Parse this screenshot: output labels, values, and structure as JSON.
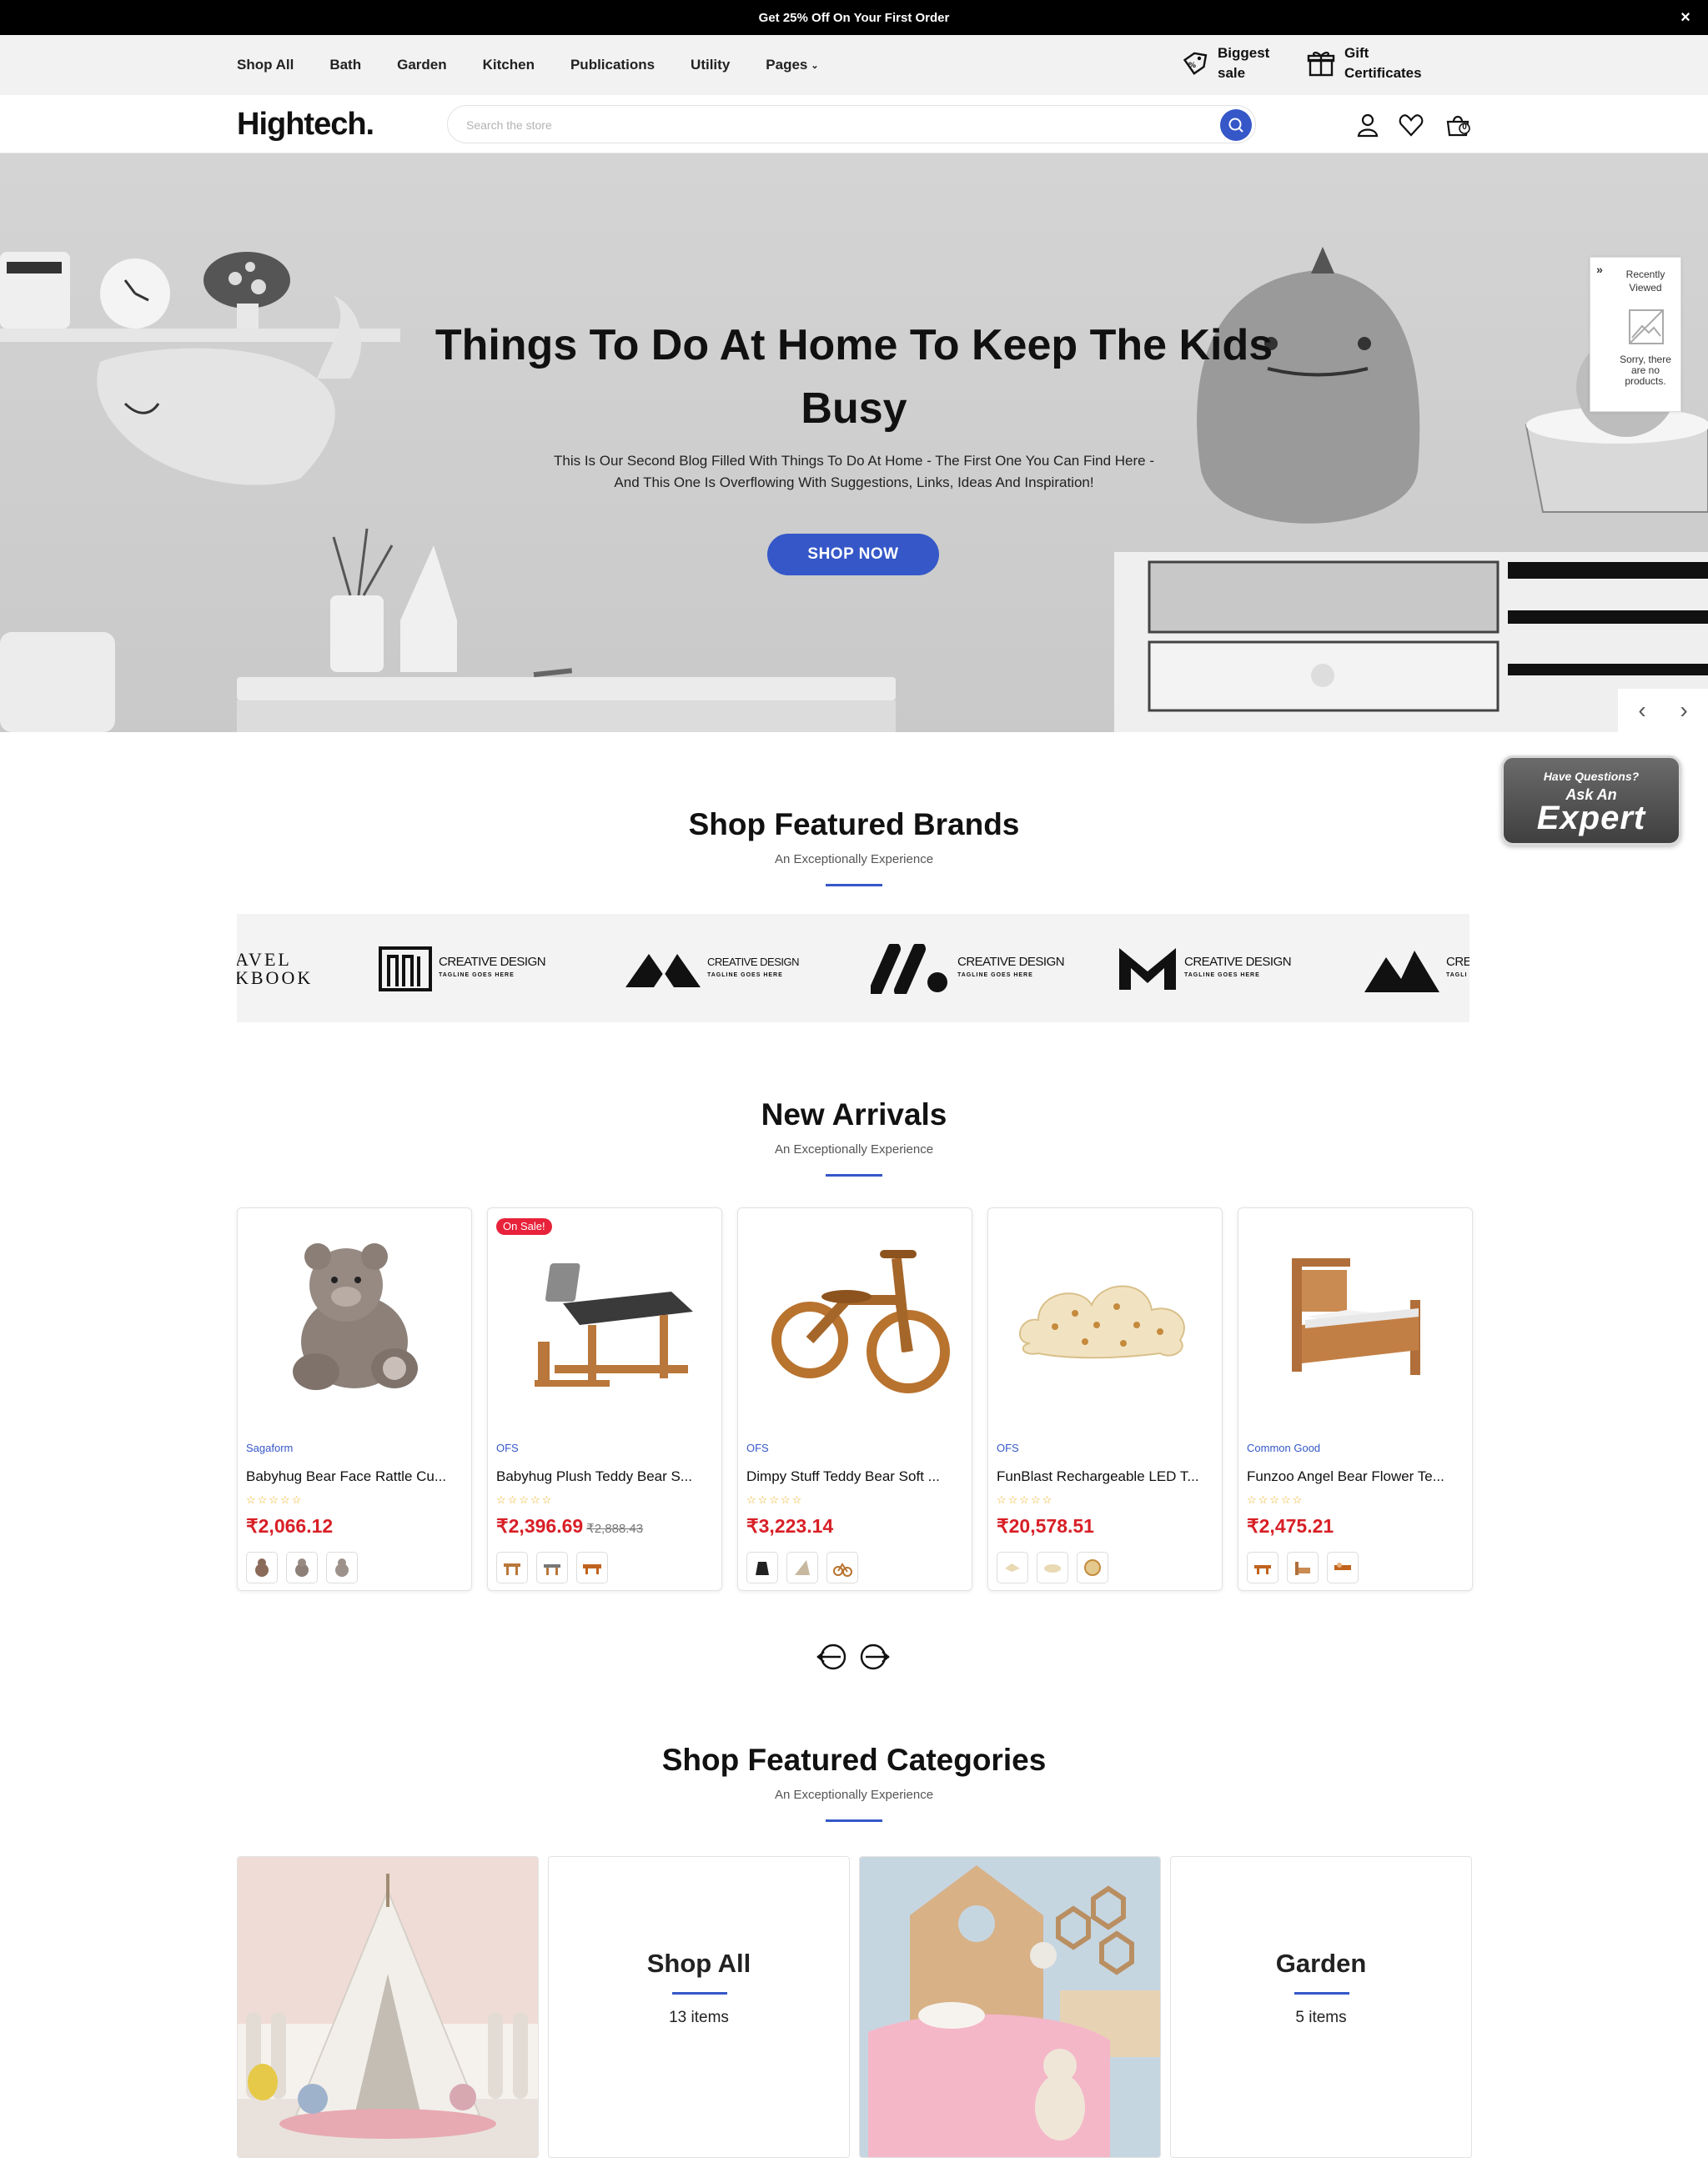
{
  "announcement": {
    "text": "Get 25% Off On Your First Order",
    "close": "×"
  },
  "nav": {
    "items": [
      "Shop All",
      "Bath",
      "Garden",
      "Kitchen",
      "Publications",
      "Utility",
      "Pages"
    ],
    "promos": [
      {
        "label_line1": "Biggest",
        "label_line2": "sale",
        "icon": "tag-icon"
      },
      {
        "label_line1": "Gift",
        "label_line2": "Certificates",
        "icon": "gift-icon"
      }
    ]
  },
  "header": {
    "logo": "Hightech.",
    "search_placeholder": "Search the store",
    "cart_count": "0"
  },
  "hero": {
    "title": "Things To Do At Home To Keep The Kids Busy",
    "subtitle": "This Is Our Second Blog Filled With Things To Do At Home - The First One You Can Find Here - And This One Is Overflowing With Suggestions, Links, Ideas And Inspiration!",
    "button": "SHOP NOW",
    "recently_viewed": {
      "title": "Recently Viewed",
      "empty": "Sorry, there are no products.",
      "toggle": "»"
    }
  },
  "expert": {
    "line1": "Have Questions?",
    "line2": "Ask An",
    "line3": "Expert"
  },
  "brands_section": {
    "title": "Shop Featured Brands",
    "subtitle": "An Exceptionally Experience",
    "brands": [
      {
        "name": "AVEL",
        "tagline": "KBOOK"
      },
      {
        "name": "CREATIVE DESIGN",
        "tagline": "TAGLINE GOES HERE"
      },
      {
        "name": "CREATIVE DESIGN",
        "tagline": "TAGLINE GOES HERE"
      },
      {
        "name": "CREATIVE DESIGN",
        "tagline": "TAGLINE GOES HERE"
      },
      {
        "name": "CREATIVE DESIGN",
        "tagline": "TAGLINE GOES HERE"
      },
      {
        "name": "CREATI",
        "tagline": "TAGLI"
      }
    ]
  },
  "arrivals": {
    "title": "New Arrivals",
    "subtitle": "An Exceptionally Experience",
    "products": [
      {
        "brand": "Sagaform",
        "name": "Babyhug Bear Face Rattle Cu...",
        "price": "₹2,066.12",
        "old_price": "",
        "badge": "",
        "rating": "☆☆☆☆☆"
      },
      {
        "brand": "OFS",
        "name": "Babyhug Plush Teddy Bear S...",
        "price": "₹2,396.69",
        "old_price": "₹2,888.43",
        "badge": "On Sale!",
        "rating": "☆☆☆☆☆"
      },
      {
        "brand": "OFS",
        "name": "Dimpy Stuff Teddy Bear Soft ...",
        "price": "₹3,223.14",
        "old_price": "",
        "badge": "",
        "rating": "☆☆☆☆☆"
      },
      {
        "brand": "OFS",
        "name": "FunBlast Rechargeable LED T...",
        "price": "₹20,578.51",
        "old_price": "",
        "badge": "",
        "rating": "☆☆☆☆☆"
      },
      {
        "brand": "Common Good",
        "name": "Funzoo Angel Bear Flower Te...",
        "price": "₹2,475.21",
        "old_price": "",
        "badge": "",
        "rating": "☆☆☆☆☆"
      }
    ]
  },
  "categories": {
    "title": "Shop Featured Categories",
    "subtitle": "An Exceptionally Experience",
    "items": [
      {
        "name": "Shop All",
        "count": "13 items"
      },
      {
        "name": "Garden",
        "count": "5 items"
      }
    ]
  },
  "colors": {
    "accent": "#3557c8",
    "price": "#d81f26",
    "sale_badge": "#e8223a",
    "announce_bg": "#000000"
  }
}
